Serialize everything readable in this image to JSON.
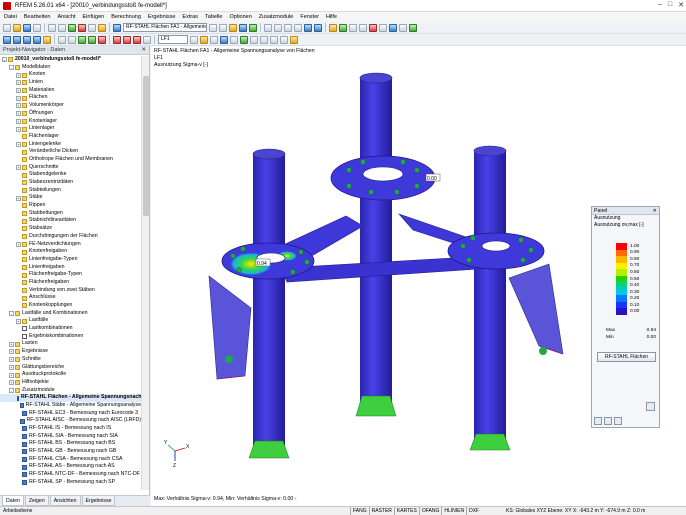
{
  "window": {
    "title": "RFEM 5.26.01 x64 - [20010_verbindungsstoß fe-modell*]",
    "controls": [
      "–",
      "□",
      "✕"
    ]
  },
  "menu": [
    "Datei",
    "Bearbeiten",
    "Ansicht",
    "Einfügen",
    "Berechnung",
    "Ergebnisse",
    "Extras",
    "Tabelle",
    "Optionen",
    "Zusatzmodule",
    "Fenster",
    "Hilfe"
  ],
  "toolbar": {
    "module_combo": "RF-STAHL Flächen FA1 - Allgemeine Sp",
    "lc_combo": "LF1"
  },
  "navigator": {
    "title": "Projekt-Navigator - Daten",
    "items": [
      {
        "label": "20010_verbindungsstoß fe-modell*",
        "level": 0,
        "exp": "-",
        "icon": "folder",
        "bold": true
      },
      {
        "label": "Modelldaten",
        "level": 1,
        "exp": "-",
        "icon": "folder"
      },
      {
        "label": "Knoten",
        "level": 2,
        "exp": "+",
        "icon": "folder"
      },
      {
        "label": "Linien",
        "level": 2,
        "exp": "+",
        "icon": "folder"
      },
      {
        "label": "Materialien",
        "level": 2,
        "exp": "+",
        "icon": "folder"
      },
      {
        "label": "Flächen",
        "level": 2,
        "exp": "+",
        "icon": "folder"
      },
      {
        "label": "Volumenkörper",
        "level": 2,
        "exp": "+",
        "icon": "folder"
      },
      {
        "label": "Öffnungen",
        "level": 2,
        "exp": "+",
        "icon": "folder"
      },
      {
        "label": "Knotenlager",
        "level": 2,
        "exp": "+",
        "icon": "folder"
      },
      {
        "label": "Linienlager",
        "level": 2,
        "exp": "+",
        "icon": "folder"
      },
      {
        "label": "Flächenlager",
        "level": 2,
        "exp": "",
        "icon": "folder"
      },
      {
        "label": "Liniengelenke",
        "level": 2,
        "exp": "+",
        "icon": "folder"
      },
      {
        "label": "Veränderliche Dicken",
        "level": 2,
        "exp": "",
        "icon": "folder"
      },
      {
        "label": "Orthotrope Flächen und Membranen",
        "level": 2,
        "exp": "",
        "icon": "folder"
      },
      {
        "label": "Querschnitte",
        "level": 2,
        "exp": "+",
        "icon": "folder"
      },
      {
        "label": "Stabendgelenke",
        "level": 2,
        "exp": "",
        "icon": "folder"
      },
      {
        "label": "Stabexzentrizitäten",
        "level": 2,
        "exp": "",
        "icon": "folder"
      },
      {
        "label": "Stabteilungen",
        "level": 2,
        "exp": "",
        "icon": "folder"
      },
      {
        "label": "Stäbe",
        "level": 2,
        "exp": "+",
        "icon": "folder"
      },
      {
        "label": "Rippen",
        "level": 2,
        "exp": "",
        "icon": "folder"
      },
      {
        "label": "Stabbettungen",
        "level": 2,
        "exp": "",
        "icon": "folder"
      },
      {
        "label": "Stabnichtlinearitäten",
        "level": 2,
        "exp": "",
        "icon": "folder"
      },
      {
        "label": "Stabsätze",
        "level": 2,
        "exp": "",
        "icon": "folder"
      },
      {
        "label": "Durchdringungen der Flächen",
        "level": 2,
        "exp": "",
        "icon": "folder"
      },
      {
        "label": "FE-Netzverdichtungen",
        "level": 2,
        "exp": "+",
        "icon": "folder"
      },
      {
        "label": "Knotenfreigaben",
        "level": 2,
        "exp": "",
        "icon": "folder"
      },
      {
        "label": "Linienfreigabe-Typen",
        "level": 2,
        "exp": "",
        "icon": "folder"
      },
      {
        "label": "Linienfreigaben",
        "level": 2,
        "exp": "",
        "icon": "folder"
      },
      {
        "label": "Flächenfreigabe-Typen",
        "level": 2,
        "exp": "",
        "icon": "folder"
      },
      {
        "label": "Flächenfreigaben",
        "level": 2,
        "exp": "",
        "icon": "folder"
      },
      {
        "label": "Verbindung von zwei Stäben",
        "level": 2,
        "exp": "",
        "icon": "folder"
      },
      {
        "label": "Anschlüsse",
        "level": 2,
        "exp": "",
        "icon": "folder"
      },
      {
        "label": "Knotenkopplungen",
        "level": 2,
        "exp": "",
        "icon": "folder"
      },
      {
        "label": "Lastfälle und Kombinationen",
        "level": 1,
        "exp": "-",
        "icon": "folder"
      },
      {
        "label": "Lastfälle",
        "level": 2,
        "exp": "+",
        "icon": "folder"
      },
      {
        "label": "Lastkombinationen",
        "level": 2,
        "exp": "",
        "icon": "doc"
      },
      {
        "label": "Ergebniskombinationen",
        "level": 2,
        "exp": "",
        "icon": "doc"
      },
      {
        "label": "Lasten",
        "level": 1,
        "exp": "+",
        "icon": "folder"
      },
      {
        "label": "Ergebnisse",
        "level": 1,
        "exp": "+",
        "icon": "folder"
      },
      {
        "label": "Schnitte",
        "level": 1,
        "exp": "+",
        "icon": "folder"
      },
      {
        "label": "Glättungsbereiche",
        "level": 1,
        "exp": "+",
        "icon": "folder"
      },
      {
        "label": "Ausdruckprotokolle",
        "level": 1,
        "exp": "+",
        "icon": "folder"
      },
      {
        "label": "Hilfsobjekte",
        "level": 1,
        "exp": "+",
        "icon": "folder"
      },
      {
        "label": "Zusatzmodule",
        "level": 1,
        "exp": "-",
        "icon": "folder"
      },
      {
        "label": "RF-STAHL Flächen - Allgemeine Spannungsnachweise",
        "level": 2,
        "exp": "",
        "icon": "blue",
        "bold": true,
        "sel": true
      },
      {
        "label": "RF-STAHL Stäbe - Allgemeine Spannungsanalyse",
        "level": 2,
        "exp": "",
        "icon": "blue"
      },
      {
        "label": "RF-STAHL EC3 - Bemessung nach Eurocode 3",
        "level": 2,
        "exp": "",
        "icon": "blue"
      },
      {
        "label": "RF-STAHL AISC - Bemessung nach AISC (LRFD)",
        "level": 2,
        "exp": "",
        "icon": "blue"
      },
      {
        "label": "RF-STAHL IS - Bemessung nach IS",
        "level": 2,
        "exp": "",
        "icon": "blue"
      },
      {
        "label": "RF-STAHL SIA - Bemessung nach SIA",
        "level": 2,
        "exp": "",
        "icon": "blue"
      },
      {
        "label": "RF-STAHL BS - Bemessung nach BS",
        "level": 2,
        "exp": "",
        "icon": "blue"
      },
      {
        "label": "RF-STAHL GB - Bemessung nach GB",
        "level": 2,
        "exp": "",
        "icon": "blue"
      },
      {
        "label": "RF-STAHL CSA - Bemessung nach CSA",
        "level": 2,
        "exp": "",
        "icon": "blue"
      },
      {
        "label": "RF-STAHL AS - Bemessung nach AS",
        "level": 2,
        "exp": "",
        "icon": "blue"
      },
      {
        "label": "RF-STAHL NTC-DF - Bemessung nach NTC-DF",
        "level": 2,
        "exp": "",
        "icon": "blue"
      },
      {
        "label": "RF-STAHL SP - Bemessung nach SP",
        "level": 2,
        "exp": "",
        "icon": "blue"
      }
    ],
    "tabs": [
      "Daten",
      "Zeigen",
      "Ansichten",
      "Ergebnisse"
    ]
  },
  "view": {
    "header_line1": "RF-STAHL Flächen FA1 - Allgemeine Spannungsanalyse von Flächen",
    "header_line2": "LF1",
    "header_line3": "Ausnutzung Sigma-v [-]",
    "label_a": "0.00",
    "label_b": "0.94",
    "footer": "Max: Verhältnis Sigma-v: 0.94, Min: Verhältnis Sigma-v: 0.00 -",
    "axis_x": "X",
    "axis_y": "Y",
    "axis_z": "Z"
  },
  "panel": {
    "title": "Panel",
    "label1": "Ausnutzung",
    "label2": "Ausnutzung σv,max [-]",
    "legend": [
      {
        "value": "1.00",
        "color": "#ff0000"
      },
      {
        "value": "0.90",
        "color": "#ff6a00"
      },
      {
        "value": "0.80",
        "color": "#ffb400"
      },
      {
        "value": "0.70",
        "color": "#ffee00"
      },
      {
        "value": "0.60",
        "color": "#b4f000"
      },
      {
        "value": "0.50",
        "color": "#28d200"
      },
      {
        "value": "0.40",
        "color": "#00d28c"
      },
      {
        "value": "0.30",
        "color": "#00c8e6"
      },
      {
        "value": "0.20",
        "color": "#0078ff"
      },
      {
        "value": "0.10",
        "color": "#1e32ff"
      },
      {
        "value": "0.00",
        "color": "#2814c8"
      }
    ],
    "max_label": "Max",
    "max_value": "0.94",
    "min_label": "Min",
    "min_value": "0.00",
    "button": "RF-STAHL Flächen"
  },
  "statusbar": {
    "left": "Arbeitsebene",
    "toggles": [
      "FANG",
      "RASTER",
      "KARTES",
      "OFANG",
      "HLINIEN",
      "DXF"
    ],
    "coords": "KS: Globales XYZ  Ebene: XY      X: -643.2 m   Y: -674.9 m   Z: 0.0 m"
  },
  "colors": {
    "steel": "#3b35d6",
    "steel_dark": "#24209a",
    "support": "#3ecf3e",
    "hotspot": "#ffe600"
  }
}
